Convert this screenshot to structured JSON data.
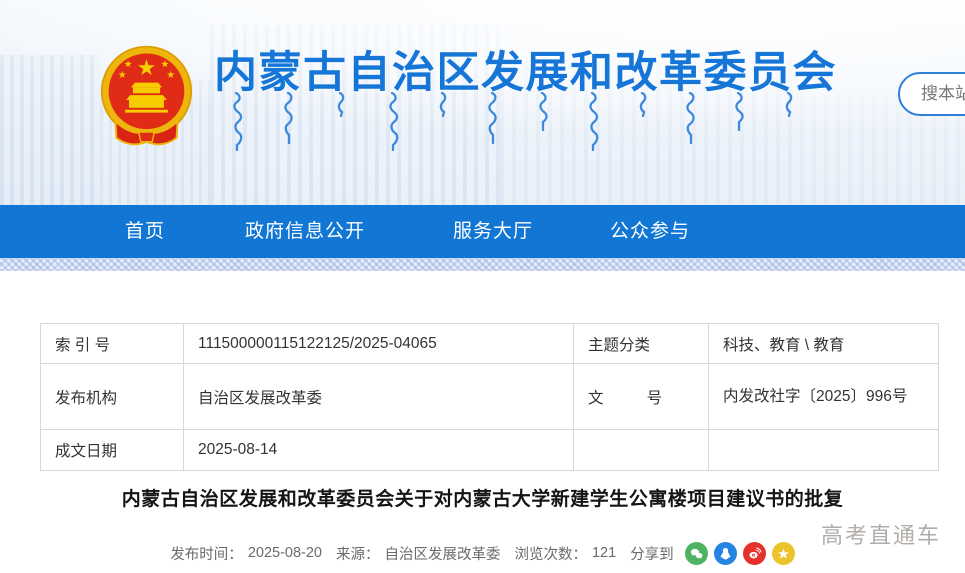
{
  "header": {
    "site_title": "内蒙古自治区发展和改革委员会",
    "search_placeholder": "搜本站",
    "emblem": "china-national-emblem",
    "subtitle_script": "mongolian-script-decoration"
  },
  "nav": {
    "items": [
      "首页",
      "政府信息公开",
      "服务大厅",
      "公众参与"
    ],
    "bar_color": "#1277d4"
  },
  "doc_info": {
    "rows": [
      {
        "label1": "索 引 号",
        "value1": "111500000115122125/2025-04065",
        "label2": "主题分类",
        "value2": "科技、教育 \\ 教育"
      },
      {
        "label1": "发布机构",
        "value1": "自治区发展改革委",
        "label2": "文          号",
        "value2": "内发改社字〔2025〕996号"
      },
      {
        "label1": "成文日期",
        "value1": "2025-08-14",
        "label2": "",
        "value2": ""
      }
    ]
  },
  "article": {
    "title": "内蒙古自治区发展和改革委员会关于对内蒙古大学新建学生公寓楼项目建议书的批复",
    "meta": {
      "publish_label": "发布时间：",
      "publish_date": "2025-08-20",
      "source_label": "来源：",
      "source": "自治区发展改革委",
      "views_label": "浏览次数：",
      "views": "121",
      "share_label": "分享到"
    },
    "share_icons": [
      {
        "name": "wechat-share-icon",
        "color": "#4eb363"
      },
      {
        "name": "qq-share-icon",
        "color": "#2583e2"
      },
      {
        "name": "weibo-share-icon",
        "color": "#e6302c"
      },
      {
        "name": "qzone-share-icon",
        "color": "#edc32a"
      }
    ]
  },
  "watermark": {
    "text": "高考直通车"
  },
  "colors": {
    "title_blue": "#1576d7",
    "nav_blue": "#1277d4",
    "mongolian_blue": "#3c89dd",
    "table_border": "#d8d8d8",
    "meta_gray": "#6a6a6a"
  }
}
